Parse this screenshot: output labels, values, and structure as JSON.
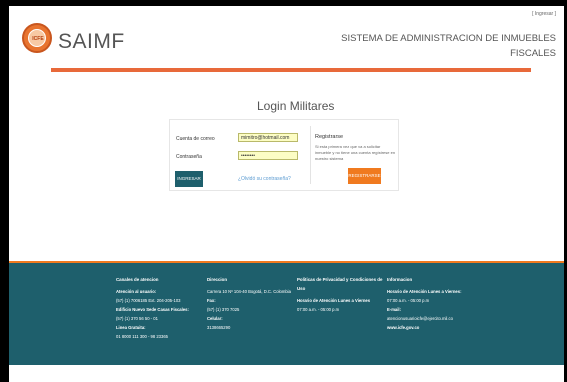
{
  "header": {
    "login_link": "[ Ingresar ]",
    "logo_text": "ICFE",
    "brand": "SAIMF",
    "system_title": "SISTEMA DE ADMINISTRACION DE INMUEBLES FISCALES"
  },
  "login": {
    "title": "Login Militares",
    "email_label": "Cuenta de correo",
    "email_value": "mimitro@hotmail.com",
    "password_label": "Contraseña",
    "password_value": "••••••••",
    "ingresar_button": "INGRESAR",
    "forgot_link": "¿Olvidó su contraseña?",
    "register_title": "Registrarse",
    "register_desc": "Si esta primera vez que va a solicitar inmueble y no tiene una cuenta regístrese en nuestro sistema",
    "register_button": "REGISTRARSE"
  },
  "footer": {
    "col1": {
      "title": "Canales de atencion",
      "l1": "Atención al usuario:",
      "l2": "(57) (1) 7006185 Ext. 204-205-103",
      "l3": "Edificio Nuevo Sede Casas Fiscales:",
      "l4": "(57) (1) 370 56 50 - 01",
      "l5": "Linea Gratuita:",
      "l6": "01 8000 111 300 - 98 23365"
    },
    "col2": {
      "title": "Direccion",
      "l1": "Carrera 10 Nº 104-40 Bogotá, D.C. Colombia",
      "l2": "Fax:",
      "l3": "(57) (1) 370 7025",
      "l4": "Celular:",
      "l5": "3138665290"
    },
    "col3": {
      "title": "Politicas de Privacidad y Condiciones de Uso",
      "l1": "Horario de Atención Lunes a Viernes",
      "l2": "07:00 a.m. - 05:00 p.m"
    },
    "col4": {
      "title": "Informacion",
      "l1": "Horario de Atención Lunes a Viernes:",
      "l2": "07:00 a.m. - 05:00 p.m",
      "l3": "E-mail:",
      "l4": "atencionusuarioicfe@ejercito.mil.co",
      "l5": "www.icfe.gov.co"
    }
  }
}
